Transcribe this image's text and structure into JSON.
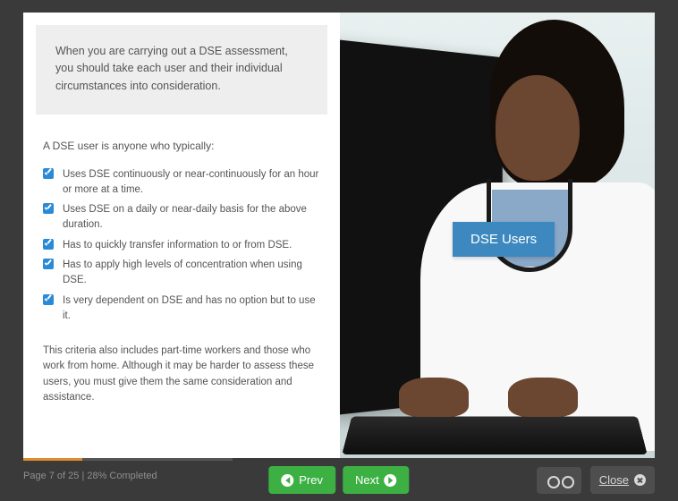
{
  "intro": "When you are carrying out a DSE assessment, you should take each user and their individual circumstances into consideration.",
  "subhead": "A DSE user is anyone who typically:",
  "bullets": [
    "Uses DSE continuously or near-continuously for an hour or more at a time.",
    "Uses DSE on a daily or near-daily basis for the above duration.",
    "Has to quickly transfer information to or from DSE.",
    "Has to apply high levels of concentration when using DSE.",
    "Is very dependent on DSE and has no option but to use it."
  ],
  "criteria_note": "This criteria also includes part-time workers and those who work from home. Although it may be harder to assess these users, you must give them the same consideration and assistance.",
  "badge": "DSE Users",
  "footer": {
    "page_label": "Page 7 of 25 | 28% Completed",
    "progress_percent": 28,
    "prev": "Prev",
    "next": "Next",
    "close": "Close"
  }
}
